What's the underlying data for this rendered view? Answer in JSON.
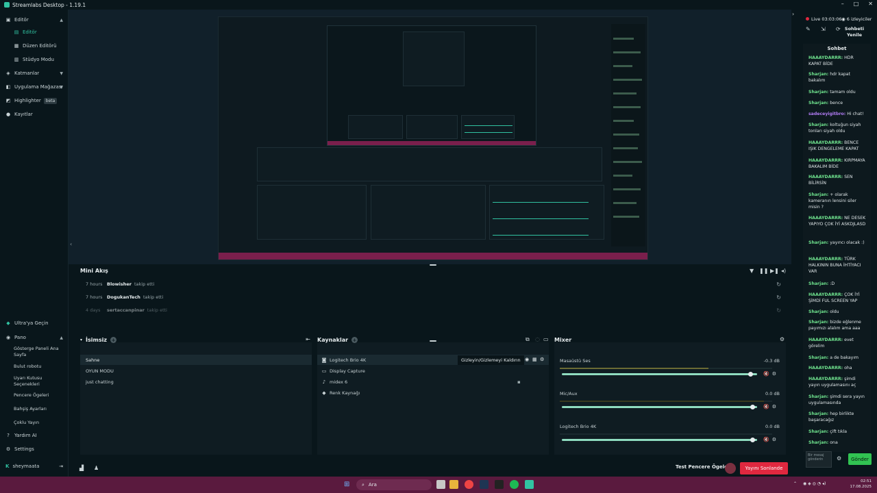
{
  "window": {
    "title": "Streamlabs Desktop - 1.19.1"
  },
  "sidebar": {
    "editor": "Editör",
    "editor_sub": "Editör",
    "layout_editor": "Düzen Editörü",
    "studio_mode": "Stüdyo Modu",
    "layers": "Katmanlar",
    "app_store": "Uygulama Mağazası",
    "highlighter": "Highlighter",
    "highlighter_badge": "beta",
    "recordings": "Kayıtlar",
    "ultra": "Ultra'ya Geçin",
    "dashboard": "Pano",
    "dash_items": [
      "Gösterge Paneli Ana Sayfa",
      "Bulut robotu",
      "Uyarı Kutusu Seçenekleri",
      "Pencere Ögeleri",
      "Bahşiş Ayarları",
      "Çoklu Yayın"
    ],
    "help_ai": "Yardım AI",
    "settings": "Settings",
    "user": "sheymaata"
  },
  "minifeed": {
    "title": "Mini Akış",
    "rows": [
      {
        "time": "7 hours",
        "name": "Blowisher",
        "action": "takip etti"
      },
      {
        "time": "7 hours",
        "name": "DogukanTech",
        "action": "takip etti"
      },
      {
        "time": "4 days",
        "name": "sertaccanpinar",
        "action": "takip etti"
      }
    ]
  },
  "scenes": {
    "title": "İsimsiz",
    "items": [
      "Sahne",
      "OYUN MODU",
      "just chatting"
    ]
  },
  "sources": {
    "title": "Kaynaklar",
    "items": [
      "Logitech Brio 4K",
      "Display Capture",
      "midex 6",
      "Renk Kaynağı"
    ],
    "tooltip": "Gizleyin/Gizlemeyi Kaldırın"
  },
  "mixer": {
    "title": "Mixer",
    "channels": [
      {
        "name": "Masaüstü Ses",
        "db": "-0.3 dB",
        "level": 0.97
      },
      {
        "name": "Mic/Aux",
        "db": "0.0 dB",
        "level": 0.98
      },
      {
        "name": "Logitech Brio 4K",
        "db": "0.0 dB",
        "level": 0.98
      }
    ]
  },
  "footer": {
    "test_widgets": "Test Pencere Ögeleri",
    "go_live": "Yayını Sonlande"
  },
  "chat": {
    "live": "Live 03:03:06",
    "viewers": "6 izleyiciler",
    "refresh": "Sohbeti Yenile",
    "title": "Sohbet",
    "messages": [
      {
        "user": "HAAAYDARRR:",
        "color": "#6fe38e",
        "text": "HDR KAPAT BİDE"
      },
      {
        "user": "Sharjan:",
        "color": "#6fe38e",
        "text": "hdr kapat bakalım"
      },
      {
        "user": "Sharjan:",
        "color": "#6fe38e",
        "text": "tamam oldu"
      },
      {
        "user": "Sharjan:",
        "color": "#6fe38e",
        "text": "bence"
      },
      {
        "user": "sadeceyigitbro:",
        "color": "#b27cf5",
        "text": "Hi chat!"
      },
      {
        "user": "Sharjan:",
        "color": "#6fe38e",
        "text": "koltuğun siyah tonları siyah oldu"
      },
      {
        "user": "HAAAYDARRR:",
        "color": "#6fe38e",
        "text": "BENCE IŞIK DENGELEME KAPAT"
      },
      {
        "user": "HAAAYDARRR:",
        "color": "#6fe38e",
        "text": "KIRPMAYA BAKALIM BİDE"
      },
      {
        "user": "HAAAYDARRR:",
        "color": "#6fe38e",
        "text": "SEN BİLİRSİN"
      },
      {
        "user": "Sharjan:",
        "color": "#6fe38e",
        "text": "+ olarak kameranın lensini siler misin ?"
      },
      {
        "user": "HAAAYDARRR:",
        "color": "#6fe38e",
        "text": "NE DESEK YAPIYO ÇOK İYİ ASKDJLASD"
      },
      {
        "user": "Sharjan:",
        "color": "#6fe38e",
        "text": "yayıncı olacak :)"
      },
      {
        "user": "HAAAYDARRR:",
        "color": "#6fe38e",
        "text": "TÜRK HALKININ BUNA İHTİYACI VAR"
      },
      {
        "user": "Sharjan:",
        "color": "#6fe38e",
        "text": ":D"
      },
      {
        "user": "HAAAYDARRR:",
        "color": "#6fe38e",
        "text": "ÇOK İYİ ŞİMDİ FUL SCREEN YAP"
      },
      {
        "user": "Sharjan:",
        "color": "#6fe38e",
        "text": "oldu"
      },
      {
        "user": "Sharjan:",
        "color": "#6fe38e",
        "text": "bizde eğlenme payımızı alalım ama aaa"
      },
      {
        "user": "HAAAYDARRR:",
        "color": "#6fe38e",
        "text": "evet görelim"
      },
      {
        "user": "Sharjan:",
        "color": "#6fe38e",
        "text": "a de bakayım"
      },
      {
        "user": "HAAAYDARRR:",
        "color": "#6fe38e",
        "text": "oha"
      },
      {
        "user": "HAAAYDARRR:",
        "color": "#6fe38e",
        "text": "şimdi yayın uygulamasını aç"
      },
      {
        "user": "Sharjan:",
        "color": "#6fe38e",
        "text": "şimdi sera yayın uygulamasında"
      },
      {
        "user": "Sharjan:",
        "color": "#6fe38e",
        "text": "hep birlikte başaracağız"
      },
      {
        "user": "Sharjan:",
        "color": "#6fe38e",
        "text": "çift tıkla"
      },
      {
        "user": "Sharjan:",
        "color": "#6fe38e",
        "text": "ona"
      }
    ],
    "input_placeholder": "Bir mesaj gönderin",
    "send": "Gönder"
  },
  "taskbar": {
    "search": "Ara",
    "time": "02:51",
    "date": "17.08.2025"
  }
}
